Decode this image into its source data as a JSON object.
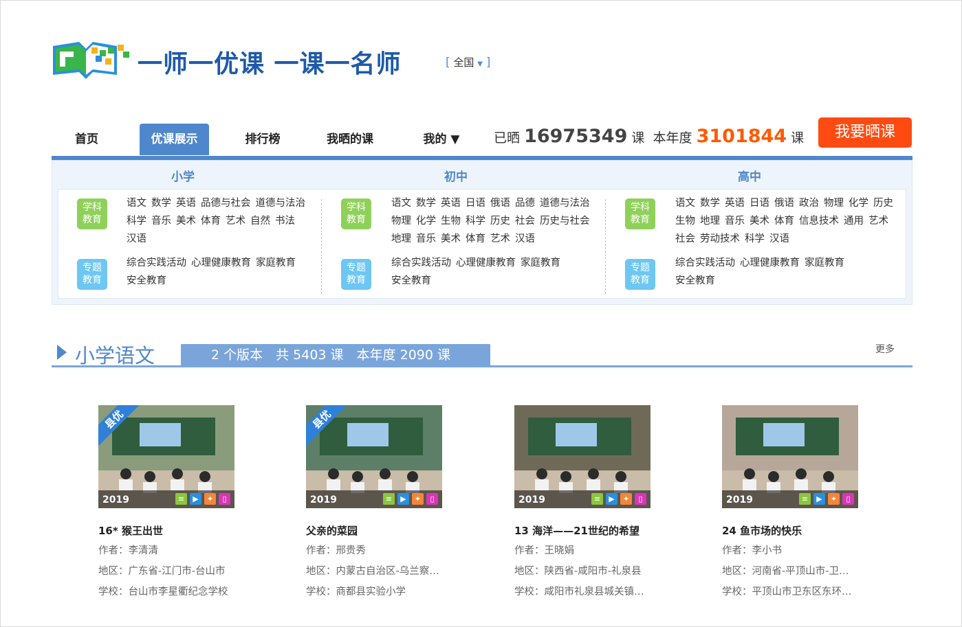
{
  "header": {
    "slogan": "一师一优课 一课一名师",
    "region_open": "[",
    "region": "全国",
    "region_arrow": "▼",
    "region_close": "]"
  },
  "nav": {
    "items": [
      "首页",
      "优课展示",
      "排行榜",
      "我晒的课",
      "我的 ▼"
    ],
    "active": "优课展示"
  },
  "stats": {
    "label1": "已晒",
    "total": "16975349",
    "unit1": "课",
    "label2": "本年度",
    "year_total": "3101844",
    "unit2": "课"
  },
  "share_button": "我要晒课",
  "levels": [
    {
      "title": "小学",
      "subject_badge": [
        "学科",
        "教育"
      ],
      "subjects": [
        "语文",
        "数学",
        "英语",
        "品德与社会",
        "道德与法治",
        "科学",
        "音乐",
        "美术",
        "体育",
        "艺术",
        "自然",
        "书法",
        "汉语"
      ],
      "topic_badge": [
        "专题",
        "教育"
      ],
      "topics": [
        "综合实践活动",
        "心理健康教育",
        "家庭教育",
        "安全教育"
      ]
    },
    {
      "title": "初中",
      "subject_badge": [
        "学科",
        "教育"
      ],
      "subjects": [
        "语文",
        "数学",
        "英语",
        "日语",
        "俄语",
        "品德",
        "道德与法治",
        "物理",
        "化学",
        "生物",
        "科学",
        "历史",
        "社会",
        "历史与社会",
        "地理",
        "音乐",
        "美术",
        "体育",
        "艺术",
        "汉语"
      ],
      "topic_badge": [
        "专题",
        "教育"
      ],
      "topics": [
        "综合实践活动",
        "心理健康教育",
        "家庭教育",
        "安全教育"
      ]
    },
    {
      "title": "高中",
      "subject_badge": [
        "学科",
        "教育"
      ],
      "subjects": [
        "语文",
        "数学",
        "英语",
        "日语",
        "俄语",
        "政治",
        "物理",
        "化学",
        "历史",
        "生物",
        "地理",
        "音乐",
        "美术",
        "体育",
        "信息技术",
        "通用",
        "艺术",
        "社会",
        "劳动技术",
        "科学",
        "汉语"
      ],
      "topic_badge": [
        "专题",
        "教育"
      ],
      "topics": [
        "综合实践活动",
        "心理健康教育",
        "家庭教育",
        "安全教育"
      ]
    }
  ],
  "section": {
    "title": "小学语文",
    "stats": "2 个版本　共 5403 课　本年度 2090 课",
    "more": "更多"
  },
  "cards": [
    {
      "ribbon": "县优",
      "year": "2019",
      "title": "16* 猴王出世",
      "author": "作者：李清清",
      "region": "地区：广东省-江门市-台山市",
      "school": "学校：台山市李星衢纪念学校",
      "scene": "#8a9c7c"
    },
    {
      "ribbon": "县优",
      "year": "2019",
      "title": "父亲的菜园",
      "author": "作者：邢贵秀",
      "region": "地区：内蒙古自治区-乌兰察…",
      "school": "学校：商都县实验小学",
      "scene": "#5d7f67"
    },
    {
      "ribbon": "",
      "year": "2019",
      "title": "13 海洋——21世纪的希望",
      "author": "作者：王晓娟",
      "region": "地区：陕西省-咸阳市-礼泉县",
      "school": "学校：咸阳市礼泉县城关镇…",
      "scene": "#6f6a58"
    },
    {
      "ribbon": "",
      "year": "2019",
      "title": "24 鱼市场的快乐",
      "author": "作者：李小书",
      "region": "地区：河南省-平顶山市-卫…",
      "school": "学校：平顶山市卫东区东环…",
      "scene": "#b6a79a"
    }
  ],
  "card_icons": [
    "note-icon",
    "video-icon",
    "lightbulb-icon",
    "tablet-icon"
  ]
}
